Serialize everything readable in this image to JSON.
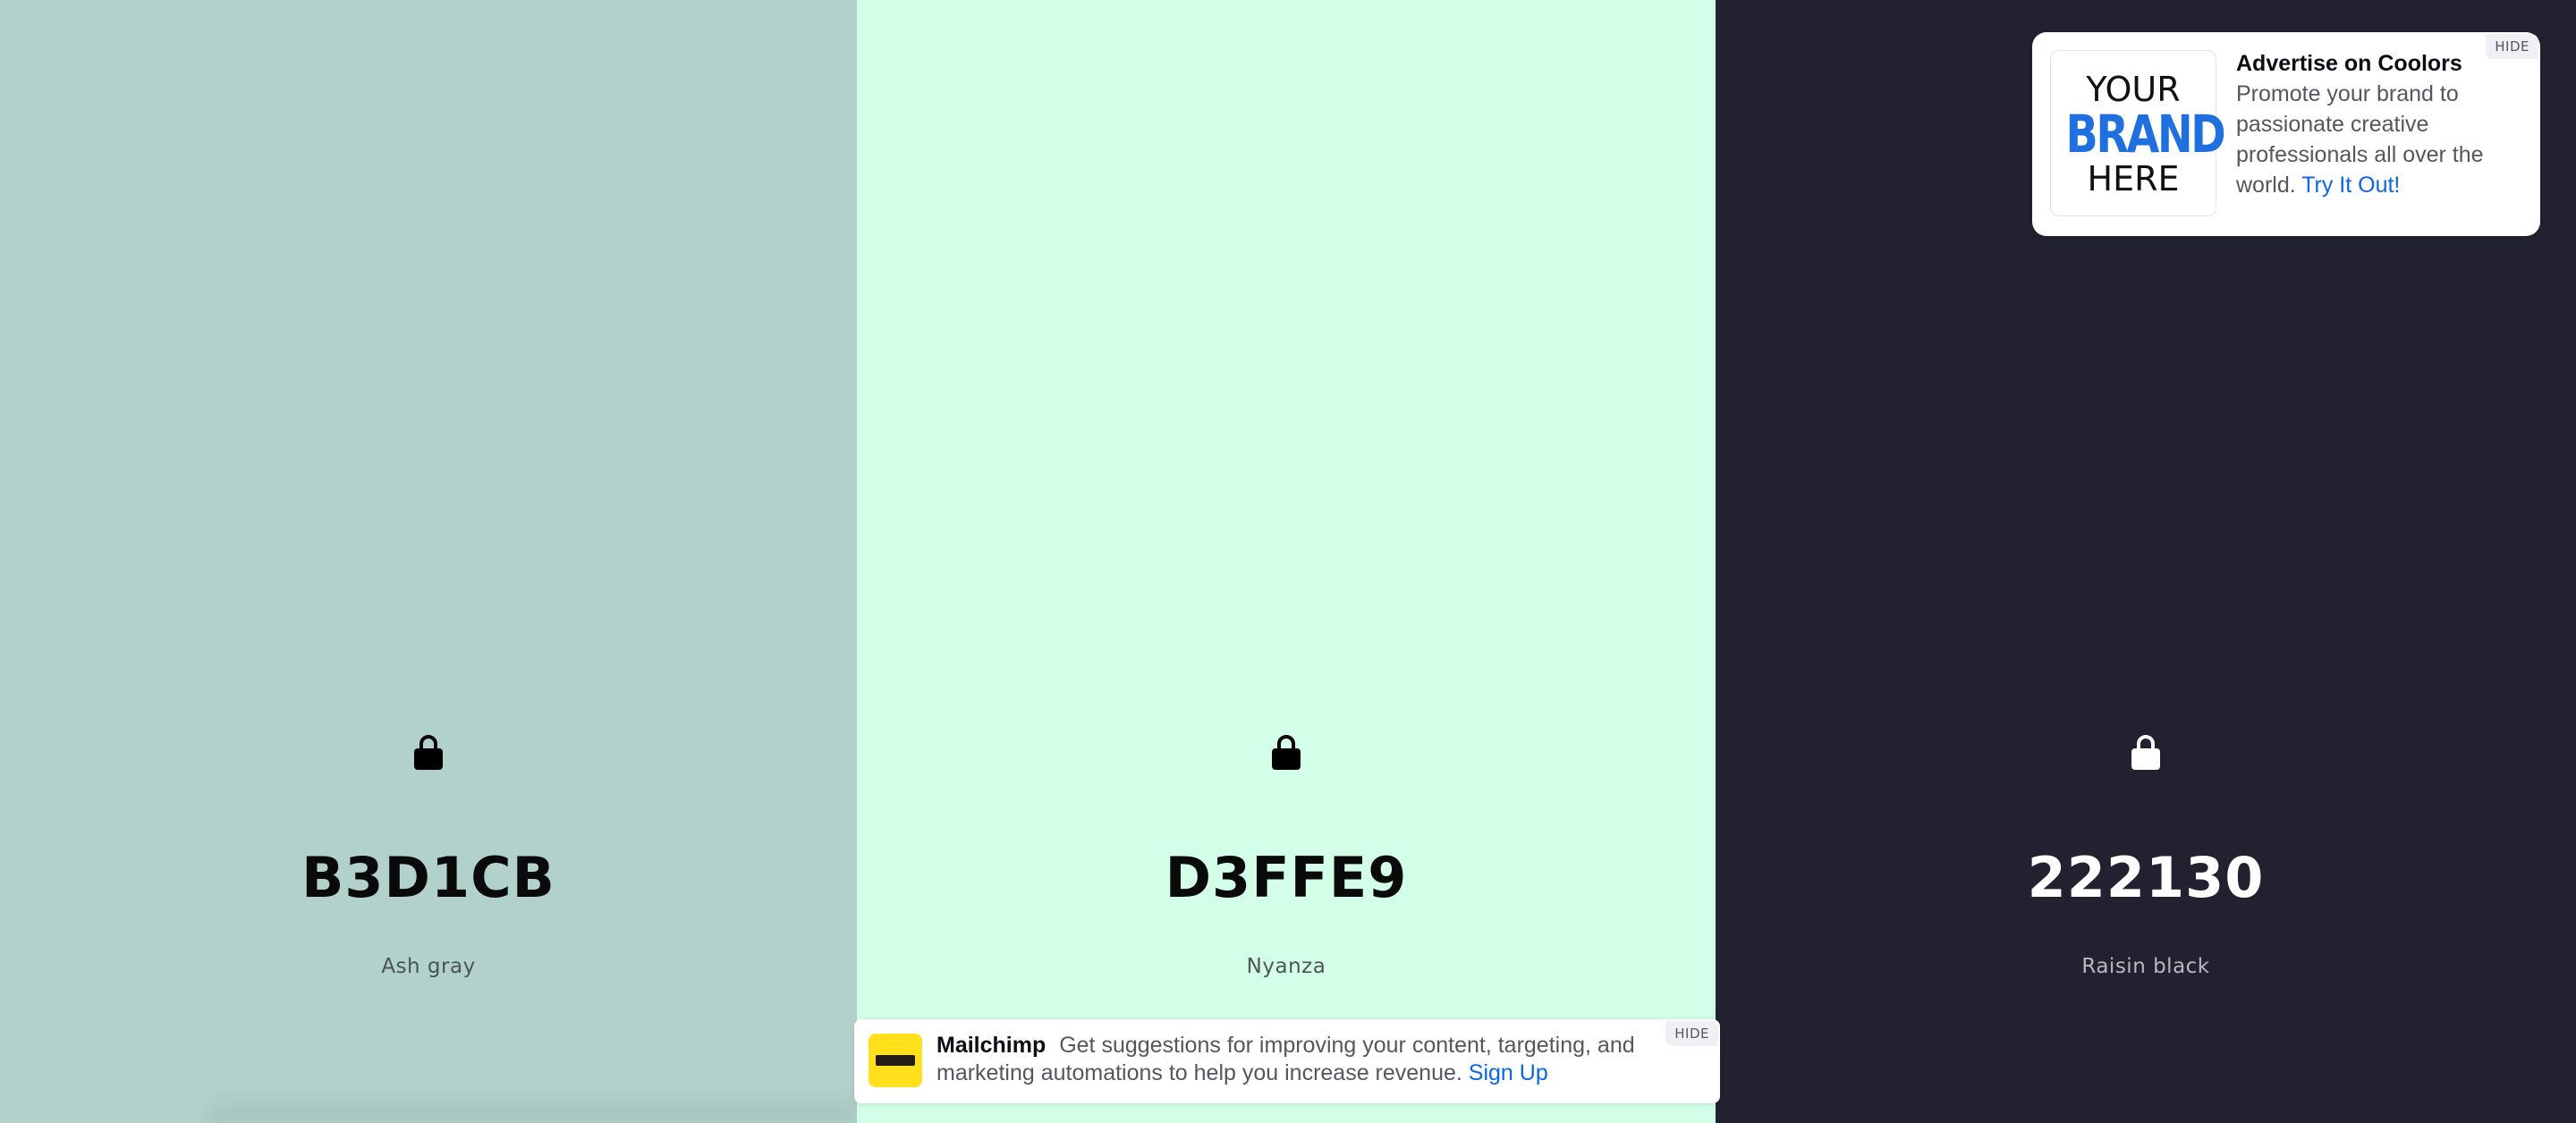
{
  "colors": [
    {
      "hex": "B3D1CB",
      "name": "Ash gray",
      "bg": "#B3D1CB",
      "fg": "#0a0a0a",
      "name_color": "#4a5552",
      "lock_color": "#000000",
      "lock_icon": "lock-icon"
    },
    {
      "hex": "D3FFE9",
      "name": "Nyanza",
      "bg": "#D3FFE9",
      "fg": "#0a0a0a",
      "name_color": "#4e5752",
      "lock_color": "#000000",
      "lock_icon": "lock-icon"
    },
    {
      "hex": "222130",
      "name": "Raisin black",
      "bg": "#222130",
      "fg": "#ffffff",
      "name_color": "#b8b8c2",
      "lock_color": "#ffffff",
      "lock_icon": "lock-icon"
    }
  ],
  "ad_top": {
    "logo_lines": [
      "YOUR",
      "BRAND",
      "HERE"
    ],
    "title": "Advertise on Coolors",
    "body": "Promote your brand to passionate creative professionals all over the world.",
    "link": "Try It Out!",
    "hide": "HIDE"
  },
  "ad_bottom": {
    "brand": "Mailchimp",
    "body": "Get suggestions for improving your content, targeting, and marketing automations to help you increase revenue.",
    "link": "Sign Up",
    "hide": "HIDE",
    "logo_color": "#FFE01B"
  },
  "accent": "#0A66E3"
}
